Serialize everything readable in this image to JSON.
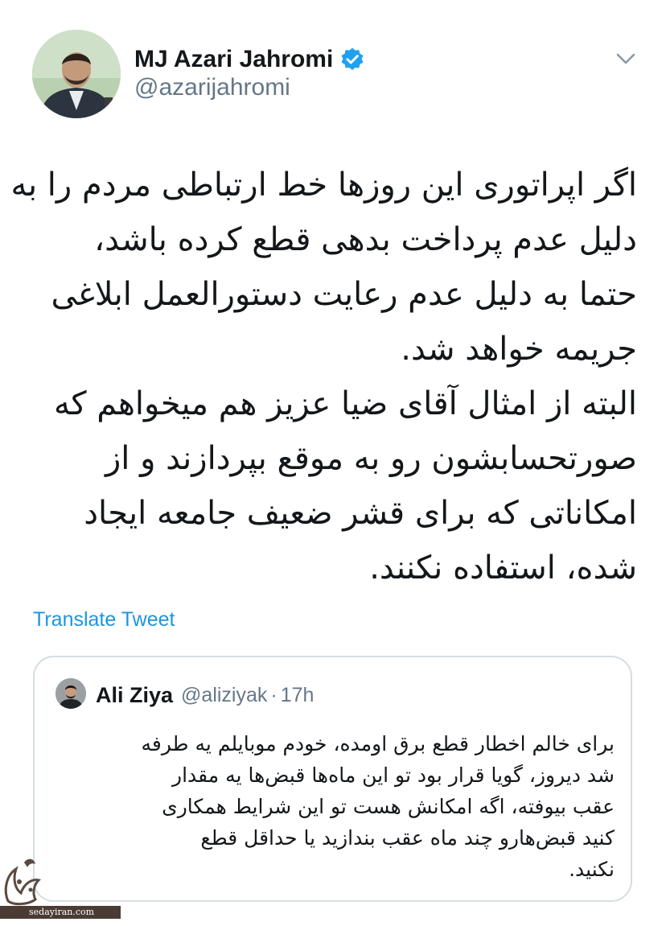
{
  "author": {
    "display_name": "MJ Azari Jahromi",
    "handle": "@azarijahromi",
    "verified_icon": "verified-badge-icon",
    "menu_icon": "chevron-down-icon"
  },
  "tweet": {
    "lines": [
      "اگر اپراتوری این روزها خط ارتباطی مردم را به",
      "دلیل عدم پرداخت بدهی قطع کرده باشد،",
      "حتما به دلیل عدم رعایت دستورالعمل ابلاغی",
      "جریمه خواهد شد.",
      "البته از امثال آقای ضیا عزیز هم میخواهم که",
      "صورتحسابشون رو به موقع بپردازند و از",
      "امکاناتی که برای قشر ضعیف جامعه ایجاد",
      "شده، استفاده نکنند."
    ],
    "translate_label": "Translate Tweet"
  },
  "quoted_tweet": {
    "name": "Ali Ziya",
    "handle": "@aliziyak",
    "separator": "·",
    "time": "17h",
    "lines": [
      "برای خالم اخطار قطع برق اومده، خودم موبایلم یه طرفه",
      "شد دیروز، گویا قرار بود تو این ماه‌ها قبض‌ها یه مقدار",
      "عقب بیوفته، اگه امکانش هست تو این شرایط همکاری",
      "کنید قبض‌هارو چند ماه عقب بندازید یا حداقل قطع",
      "نکنید."
    ]
  },
  "watermark": {
    "site": "sedayiran.com",
    "logo_text": "صدای ایران"
  },
  "colors": {
    "text": "#14171a",
    "secondary": "#657786",
    "link": "#1b95e0",
    "verified": "#1da1f2",
    "border": "#d6dde3"
  }
}
